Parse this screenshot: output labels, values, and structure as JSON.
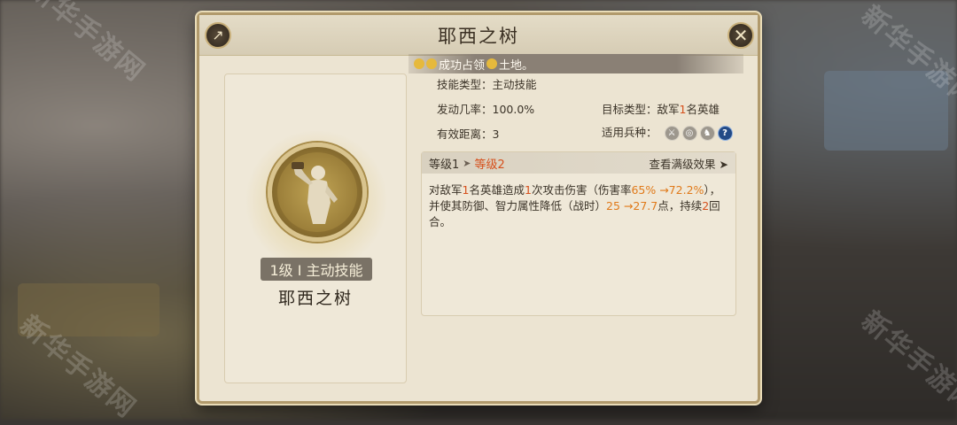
{
  "modal": {
    "title": "耶西之树",
    "share_icon": "share-icon",
    "close_icon": "close-icon"
  },
  "notice": {
    "text1": "成功占领",
    "text2": "土地。"
  },
  "skill": {
    "tag": "1级 I 主动技能",
    "name": "耶西之树"
  },
  "info": {
    "type_label": "技能类型：主动技能",
    "rate_label": "发动几率：100.0%",
    "range_label": "有效距离：3",
    "target_prefix": "目标类型：敌军",
    "target_num": "1",
    "target_suffix": "名英雄",
    "troop_label": "适用兵种：",
    "troops": [
      "sword-icon",
      "shield-icon",
      "horse-icon",
      "question-icon"
    ]
  },
  "level": {
    "current": "等级1",
    "next": "等级2",
    "full_link": "查看满级效果"
  },
  "desc": {
    "p1": "对敌军",
    "n1": "1",
    "p2": "名英雄造成",
    "n2": "1",
    "p3": "次攻击伤害（伤害率",
    "v1": "65% →72.2%",
    "p4": "），并使其防御、智力属性降低（战时）",
    "v2": "25 →27.7",
    "p5": "点，持续",
    "n3": "2",
    "p6": "回合。"
  },
  "watermark": "新华手游网",
  "colors": {
    "highlight": "#d6501c",
    "accent_orange": "#e07a1a",
    "panel_bg": "#ece4d2"
  }
}
